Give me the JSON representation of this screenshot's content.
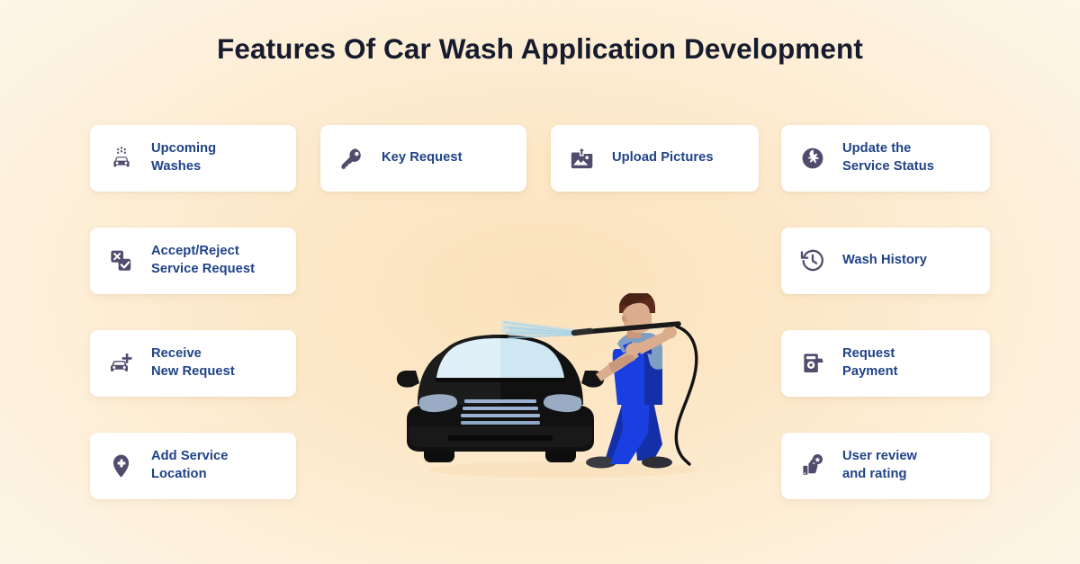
{
  "page": {
    "title": "Features Of Car Wash Application Development",
    "background_start": "#fbe2bc",
    "background_end": "#fdf6e9",
    "title_color": "#161b2e",
    "card_background": "#ffffff",
    "label_color": "#1f4287",
    "icon_color": "#514c6e"
  },
  "features": [
    {
      "id": "upcoming-washes",
      "icon": "car-wash-icon",
      "lines": [
        "Upcoming",
        "Washes"
      ],
      "column": "col-left",
      "row": "row1"
    },
    {
      "id": "key-request",
      "icon": "key-icon",
      "lines": [
        "Key Request"
      ],
      "column": "col-mid1",
      "row": "row1"
    },
    {
      "id": "upload-pictures",
      "icon": "image-upload-icon",
      "lines": [
        "Upload Pictures"
      ],
      "column": "col-mid2",
      "row": "row1"
    },
    {
      "id": "update-service-status",
      "icon": "lightning-circle-icon",
      "lines": [
        "Update the",
        "Service Status"
      ],
      "column": "col-right",
      "row": "row1"
    },
    {
      "id": "accept-reject-service-request",
      "icon": "accept-reject-icon",
      "lines": [
        "Accept/Reject",
        "Service Request"
      ],
      "column": "col-left",
      "row": "row2"
    },
    {
      "id": "wash-history",
      "icon": "history-clock-icon",
      "lines": [
        "Wash History"
      ],
      "column": "col-right",
      "row": "row2"
    },
    {
      "id": "receive-new-request",
      "icon": "car-plus-icon",
      "lines": [
        "Receive",
        "New Request"
      ],
      "column": "col-left",
      "row": "row3"
    },
    {
      "id": "request-payment",
      "icon": "atm-cash-icon",
      "lines": [
        "Request",
        "Payment"
      ],
      "column": "col-right",
      "row": "row3"
    },
    {
      "id": "add-service-location",
      "icon": "map-pin-plus-icon",
      "lines": [
        "Add Service",
        "Location"
      ],
      "column": "col-left",
      "row": "row4"
    },
    {
      "id": "user-review-and-rating",
      "icon": "thumbs-up-star-icon",
      "lines": [
        "User review",
        "and rating"
      ],
      "column": "col-right",
      "row": "row4"
    }
  ],
  "illustration": {
    "name": "car-wash-worker-illustration",
    "description": "Worker in blue overalls pressure-washing the front of a black car",
    "colors": {
      "car_body": "#111111",
      "car_body_light": "#2a2a2a",
      "windshield": "#cfe5f2",
      "grille": "#9fb4d4",
      "headlight": "#9aabc4",
      "overalls": "#1a3fe0",
      "overalls_dark": "#1430a8",
      "shirt": "#7e9ec4",
      "skin": "#dbac8e",
      "hair": "#5a2b1d",
      "shoes": "#3c3c44",
      "hose": "#1a1a1a",
      "water_spray": "#b6dcf0"
    }
  }
}
